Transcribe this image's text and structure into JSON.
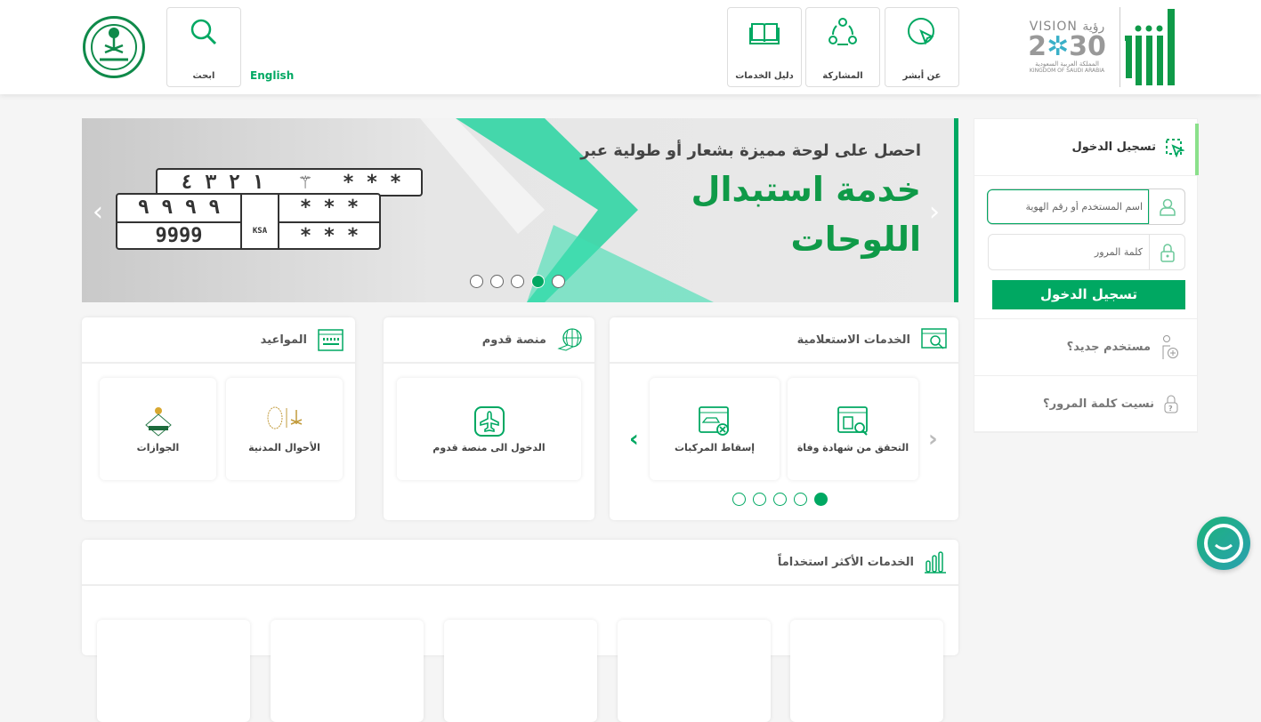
{
  "header": {
    "logo_brand": "أبشر",
    "vision_logo": "VISION رؤية 2030 المملكة العربية السعودية KINGDOM OF SAUDI ARABIA",
    "nav": [
      {
        "label": "عن أبشر",
        "icon": "cursor-circle-icon"
      },
      {
        "label": "المشاركة",
        "icon": "share-people-icon"
      },
      {
        "label": "دليل الخدمات",
        "icon": "book-icon"
      }
    ],
    "language": "English",
    "search_label": "ابحث"
  },
  "banner": {
    "subtitle": "احصل على لوحة مميزة بشعار أو طولية عبر",
    "title_line1": "خدمة استبدال",
    "title_line2": "اللوحات",
    "plate": {
      "top_digits": "١ ٢ ٣ ٤",
      "stars": "* * *",
      "digits_ar": "٩ ٩ ٩ ٩",
      "digits_en": "9999",
      "ksa": "KSA"
    },
    "slides": 5,
    "active_slide": 4
  },
  "login": {
    "title": "تسجيل الدخول",
    "username_placeholder": "اسم المستخدم أو رقم الهوية",
    "password_placeholder": "كلمة المرور",
    "submit": "تسجيل الدخول",
    "new_user": "مستخدم جديد؟",
    "forgot_password": "نسيت كلمة المرور؟"
  },
  "inquiry": {
    "title": "الخدمات الاستعلامية",
    "items": [
      "التحقق من شهادة وفاة",
      "إسقاط المركبات"
    ],
    "pages": 5,
    "active_page": 5
  },
  "arrival": {
    "title": "منصة قدوم",
    "items": [
      "الدخول الى منصة قدوم"
    ]
  },
  "appointments": {
    "title": "المواعيد",
    "items": [
      "الأحوال المدنية",
      "الجوازات"
    ],
    "civil_logo_text": "الأحوال المدنية"
  },
  "most_used": {
    "title": "الخدمات الأكثر استخداماً"
  },
  "colors": {
    "primary": "#00a862",
    "accent_light": "#8be08b"
  }
}
